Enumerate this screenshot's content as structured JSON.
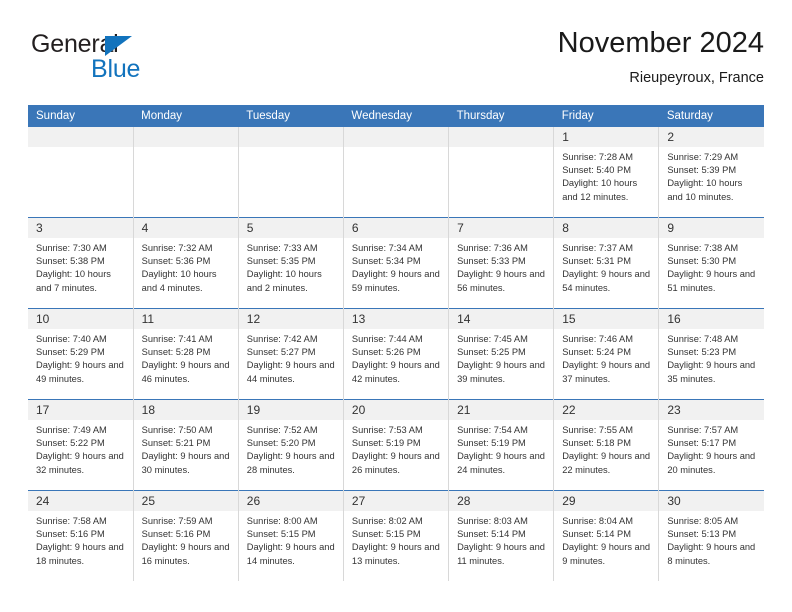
{
  "brand": {
    "name_part1": "General",
    "name_part2": "Blue",
    "logo_icon": "triangle-icon"
  },
  "header": {
    "month_title": "November 2024",
    "location": "Rieupeyroux, France"
  },
  "colors": {
    "header_blue": "#3A76B8",
    "brand_blue": "#1273BD",
    "daynum_band": "#F1F1F1",
    "text": "#333333"
  },
  "calendar": {
    "weekday_headers": [
      "Sunday",
      "Monday",
      "Tuesday",
      "Wednesday",
      "Thursday",
      "Friday",
      "Saturday"
    ],
    "weeks": [
      [
        {
          "day": "",
          "empty": true
        },
        {
          "day": "",
          "empty": true
        },
        {
          "day": "",
          "empty": true
        },
        {
          "day": "",
          "empty": true
        },
        {
          "day": "",
          "empty": true
        },
        {
          "day": "1",
          "sunrise": "Sunrise: 7:28 AM",
          "sunset": "Sunset: 5:40 PM",
          "daylight": "Daylight: 10 hours and 12 minutes."
        },
        {
          "day": "2",
          "sunrise": "Sunrise: 7:29 AM",
          "sunset": "Sunset: 5:39 PM",
          "daylight": "Daylight: 10 hours and 10 minutes."
        }
      ],
      [
        {
          "day": "3",
          "sunrise": "Sunrise: 7:30 AM",
          "sunset": "Sunset: 5:38 PM",
          "daylight": "Daylight: 10 hours and 7 minutes."
        },
        {
          "day": "4",
          "sunrise": "Sunrise: 7:32 AM",
          "sunset": "Sunset: 5:36 PM",
          "daylight": "Daylight: 10 hours and 4 minutes."
        },
        {
          "day": "5",
          "sunrise": "Sunrise: 7:33 AM",
          "sunset": "Sunset: 5:35 PM",
          "daylight": "Daylight: 10 hours and 2 minutes."
        },
        {
          "day": "6",
          "sunrise": "Sunrise: 7:34 AM",
          "sunset": "Sunset: 5:34 PM",
          "daylight": "Daylight: 9 hours and 59 minutes."
        },
        {
          "day": "7",
          "sunrise": "Sunrise: 7:36 AM",
          "sunset": "Sunset: 5:33 PM",
          "daylight": "Daylight: 9 hours and 56 minutes."
        },
        {
          "day": "8",
          "sunrise": "Sunrise: 7:37 AM",
          "sunset": "Sunset: 5:31 PM",
          "daylight": "Daylight: 9 hours and 54 minutes."
        },
        {
          "day": "9",
          "sunrise": "Sunrise: 7:38 AM",
          "sunset": "Sunset: 5:30 PM",
          "daylight": "Daylight: 9 hours and 51 minutes."
        }
      ],
      [
        {
          "day": "10",
          "sunrise": "Sunrise: 7:40 AM",
          "sunset": "Sunset: 5:29 PM",
          "daylight": "Daylight: 9 hours and 49 minutes."
        },
        {
          "day": "11",
          "sunrise": "Sunrise: 7:41 AM",
          "sunset": "Sunset: 5:28 PM",
          "daylight": "Daylight: 9 hours and 46 minutes."
        },
        {
          "day": "12",
          "sunrise": "Sunrise: 7:42 AM",
          "sunset": "Sunset: 5:27 PM",
          "daylight": "Daylight: 9 hours and 44 minutes."
        },
        {
          "day": "13",
          "sunrise": "Sunrise: 7:44 AM",
          "sunset": "Sunset: 5:26 PM",
          "daylight": "Daylight: 9 hours and 42 minutes."
        },
        {
          "day": "14",
          "sunrise": "Sunrise: 7:45 AM",
          "sunset": "Sunset: 5:25 PM",
          "daylight": "Daylight: 9 hours and 39 minutes."
        },
        {
          "day": "15",
          "sunrise": "Sunrise: 7:46 AM",
          "sunset": "Sunset: 5:24 PM",
          "daylight": "Daylight: 9 hours and 37 minutes."
        },
        {
          "day": "16",
          "sunrise": "Sunrise: 7:48 AM",
          "sunset": "Sunset: 5:23 PM",
          "daylight": "Daylight: 9 hours and 35 minutes."
        }
      ],
      [
        {
          "day": "17",
          "sunrise": "Sunrise: 7:49 AM",
          "sunset": "Sunset: 5:22 PM",
          "daylight": "Daylight: 9 hours and 32 minutes."
        },
        {
          "day": "18",
          "sunrise": "Sunrise: 7:50 AM",
          "sunset": "Sunset: 5:21 PM",
          "daylight": "Daylight: 9 hours and 30 minutes."
        },
        {
          "day": "19",
          "sunrise": "Sunrise: 7:52 AM",
          "sunset": "Sunset: 5:20 PM",
          "daylight": "Daylight: 9 hours and 28 minutes."
        },
        {
          "day": "20",
          "sunrise": "Sunrise: 7:53 AM",
          "sunset": "Sunset: 5:19 PM",
          "daylight": "Daylight: 9 hours and 26 minutes."
        },
        {
          "day": "21",
          "sunrise": "Sunrise: 7:54 AM",
          "sunset": "Sunset: 5:19 PM",
          "daylight": "Daylight: 9 hours and 24 minutes."
        },
        {
          "day": "22",
          "sunrise": "Sunrise: 7:55 AM",
          "sunset": "Sunset: 5:18 PM",
          "daylight": "Daylight: 9 hours and 22 minutes."
        },
        {
          "day": "23",
          "sunrise": "Sunrise: 7:57 AM",
          "sunset": "Sunset: 5:17 PM",
          "daylight": "Daylight: 9 hours and 20 minutes."
        }
      ],
      [
        {
          "day": "24",
          "sunrise": "Sunrise: 7:58 AM",
          "sunset": "Sunset: 5:16 PM",
          "daylight": "Daylight: 9 hours and 18 minutes."
        },
        {
          "day": "25",
          "sunrise": "Sunrise: 7:59 AM",
          "sunset": "Sunset: 5:16 PM",
          "daylight": "Daylight: 9 hours and 16 minutes."
        },
        {
          "day": "26",
          "sunrise": "Sunrise: 8:00 AM",
          "sunset": "Sunset: 5:15 PM",
          "daylight": "Daylight: 9 hours and 14 minutes."
        },
        {
          "day": "27",
          "sunrise": "Sunrise: 8:02 AM",
          "sunset": "Sunset: 5:15 PM",
          "daylight": "Daylight: 9 hours and 13 minutes."
        },
        {
          "day": "28",
          "sunrise": "Sunrise: 8:03 AM",
          "sunset": "Sunset: 5:14 PM",
          "daylight": "Daylight: 9 hours and 11 minutes."
        },
        {
          "day": "29",
          "sunrise": "Sunrise: 8:04 AM",
          "sunset": "Sunset: 5:14 PM",
          "daylight": "Daylight: 9 hours and 9 minutes."
        },
        {
          "day": "30",
          "sunrise": "Sunrise: 8:05 AM",
          "sunset": "Sunset: 5:13 PM",
          "daylight": "Daylight: 9 hours and 8 minutes."
        }
      ]
    ]
  }
}
